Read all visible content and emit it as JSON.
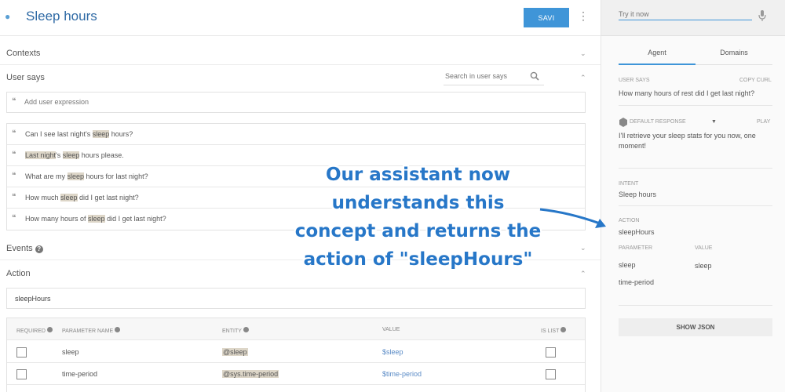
{
  "header": {
    "title": "Sleep hours",
    "save_label": "SAVI",
    "menu_icon": "kebab-menu-icon"
  },
  "sections": {
    "contexts": "Contexts",
    "user_says": "User says",
    "events": "Events",
    "action": "Action"
  },
  "search": {
    "placeholder": "Search in user says"
  },
  "add_expression": {
    "placeholder": "Add user expression"
  },
  "phrases": [
    {
      "before": "Can I see last night's ",
      "hl": "sleep",
      "after": " hours?"
    },
    {
      "hl0": "Last night",
      "mid": "'s ",
      "hl": "sleep",
      "after": " hours please."
    },
    {
      "before": "What are my ",
      "hl": "sleep",
      "after": " hours for last night?"
    },
    {
      "before": "How much ",
      "hl": "sleep",
      "after": " did I get last night?"
    },
    {
      "before": "How many hours of ",
      "hl": "sleep",
      "after": " did I get last night?"
    }
  ],
  "action": {
    "value": "sleepHours"
  },
  "param_table": {
    "headers": {
      "required": "REQUIRED",
      "name": "PARAMETER NAME",
      "entity": "ENTITY",
      "value": "VALUE",
      "is_list": "IS LIST"
    },
    "rows": [
      {
        "name": "sleep",
        "entity": "@sleep",
        "value": "$sleep",
        "required": false,
        "is_list": false
      },
      {
        "name": "time-period",
        "entity": "@sys.time-period",
        "value": "$time-period",
        "required": false,
        "is_list": false
      }
    ]
  },
  "right_panel": {
    "try_placeholder": "Try it now",
    "tabs": [
      "Agent",
      "Domains"
    ],
    "user_says_label": "USER SAYS",
    "copy_curl": "COPY CURL",
    "user_says_text": "How many hours of rest did I get last night?",
    "default_response_label": "DEFAULT RESPONSE",
    "play_label": "PLAY",
    "response_text": "I'll retrieve your sleep stats for you now, one moment!",
    "intent_label": "INTENT",
    "intent_value": "Sleep hours",
    "action_label": "ACTION",
    "action_value": "sleepHours",
    "parameter_label": "PARAMETER",
    "value_label": "VALUE",
    "params": [
      {
        "name": "sleep",
        "value": "sleep"
      },
      {
        "name": "time-period",
        "value": ""
      }
    ],
    "show_json": "SHOW JSON"
  },
  "annotation": {
    "lines": [
      "Our assistant now",
      "understands this",
      "concept and returns the",
      "action of \"sleepHours\""
    ],
    "color": "#2777c8"
  },
  "colors": {
    "accent": "#3f95d8",
    "title": "#2f6aa5",
    "highlight": "#ddd6c8"
  }
}
